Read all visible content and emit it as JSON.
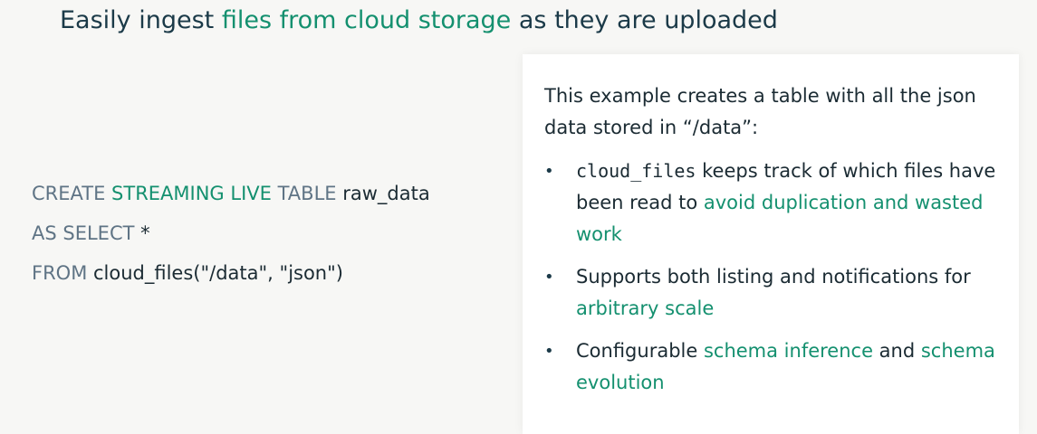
{
  "title": {
    "prefix": "Easily ingest ",
    "highlight": "files from cloud storage",
    "suffix": " as they are uploaded"
  },
  "code": {
    "line1": {
      "kw1": "CREATE ",
      "kw2": "STREAMING LIVE",
      "kw3": " TABLE ",
      "rest": "raw_data"
    },
    "line2": {
      "kw": "AS SELECT ",
      "rest": "*"
    },
    "line3": {
      "kw": "FROM ",
      "rest": "cloud_files(\"/data\", \"json\")"
    }
  },
  "panel": {
    "intro": "This example creates a table with all the json data stored in “/data”:",
    "bullet_glyph": "•",
    "bullets": [
      {
        "code": "cloud_files",
        "text": " keeps track of which files have been read to ",
        "accent": "avoid duplication and wasted work",
        "after": ""
      },
      {
        "code": "",
        "text": "Supports both listing and notifications for ",
        "accent": "arbitrary scale",
        "after": ""
      },
      {
        "code": "",
        "text": "Configurable ",
        "accent": "schema inference",
        "after": " and ",
        "accent2": "schema evolution"
      }
    ]
  },
  "colors": {
    "accent": "#14906f",
    "title": "#1b3a48",
    "keyword": "#5f7485",
    "text": "#1b2b33",
    "background": "#f7f7f5",
    "panel": "#ffffff"
  }
}
